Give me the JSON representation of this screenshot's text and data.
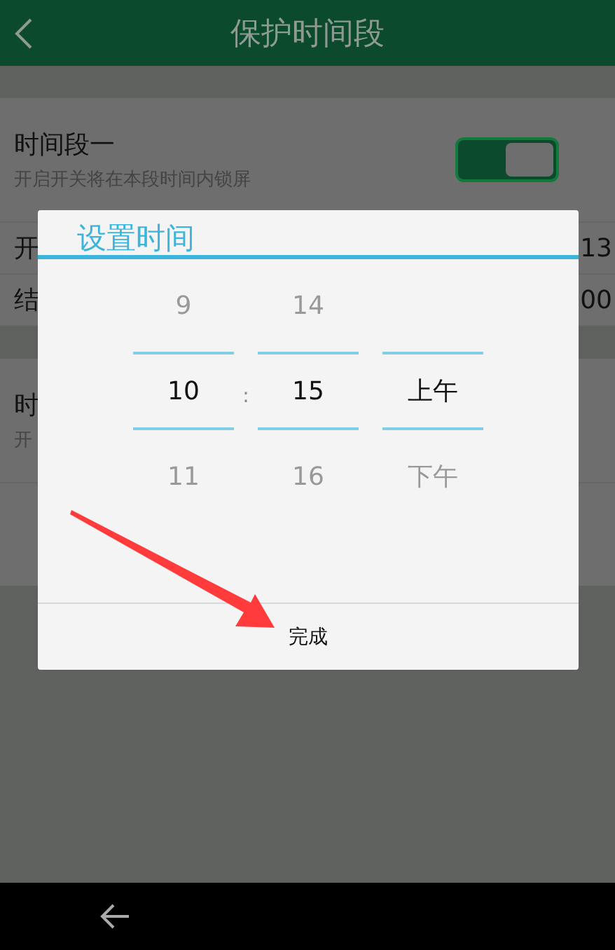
{
  "header": {
    "title": "保护时间段"
  },
  "sections": [
    {
      "title": "时间段一",
      "subtitle": "开启开关将在本段时间内锁屏",
      "on": true,
      "rows": [
        {
          "label": "开",
          "value": "13"
        },
        {
          "label": "结",
          "value": "00"
        }
      ]
    },
    {
      "title": "时",
      "subtitle": "开"
    }
  ],
  "dialog": {
    "title": "设置时间",
    "separator": ":",
    "columns": [
      {
        "above": "9",
        "value": "10",
        "below": "11"
      },
      {
        "above": "14",
        "value": "15",
        "below": "16"
      },
      {
        "value": "上午",
        "below": "下午"
      }
    ],
    "button": "完成"
  },
  "annotations": [
    {
      "kind": "arrow",
      "color": "#ff3b3b"
    }
  ]
}
